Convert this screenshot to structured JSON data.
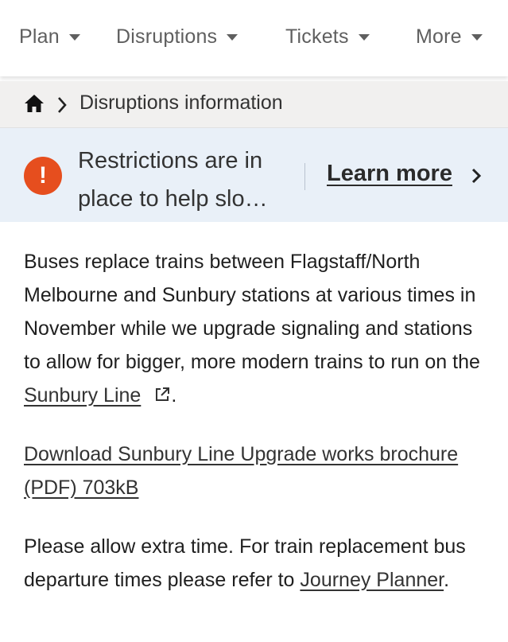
{
  "nav": {
    "items": [
      {
        "label": "Plan"
      },
      {
        "label": "Disruptions"
      },
      {
        "label": "Tickets"
      },
      {
        "label": "More"
      }
    ]
  },
  "breadcrumb": {
    "home_icon": "home-icon",
    "separator_icon": "chevron-right-icon",
    "current": "Disruptions information"
  },
  "alert": {
    "icon": "exclamation-icon",
    "text": "Restrictions are in place to help slo…",
    "link_label": "Learn more"
  },
  "content": {
    "intro_before": "Buses replace trains between Flagstaff/North Melbourne and Sunbury stations at various times in November while we upgrade signaling and stations to allow for bigger, more modern trains to run on the",
    "intro_link": "Sunbury Line",
    "intro_after": ".",
    "download_link": "Download Sunbury Line Upgrade works brochure (PDF) 703kB",
    "note_before": "Please allow extra time. For train replacement bus departure times please refer to",
    "note_link": "Journey Planner",
    "note_after": "."
  },
  "colors": {
    "alert_icon": "#e64e1e",
    "alert_bg": "#e9f0f8",
    "breadcrumb_bg": "#f1f0ef"
  }
}
